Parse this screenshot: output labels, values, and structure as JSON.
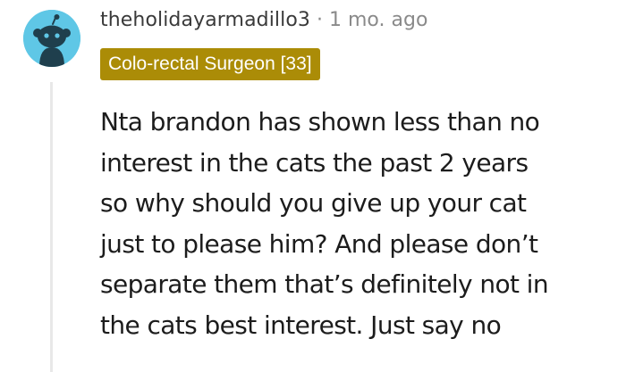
{
  "comment": {
    "username": "theholidayarmadillo3",
    "separator": "·",
    "timestamp": "1 mo. ago",
    "flair": "Colo-rectal Surgeon [33]",
    "body_lines": [
      "Nta brandon has shown less than no",
      "interest in the cats the past 2 years",
      "so why should you give up your cat",
      "just to please him? And please don’t",
      "separate them that’s definitely not in",
      "the cats best interest. Just say no"
    ]
  },
  "colors": {
    "avatar_bg": "#5fc7e6",
    "flair_bg": "#ab8c07",
    "meta_text": "#8a8a8a"
  },
  "icons": {
    "avatar": "snoo-avatar-icon"
  }
}
